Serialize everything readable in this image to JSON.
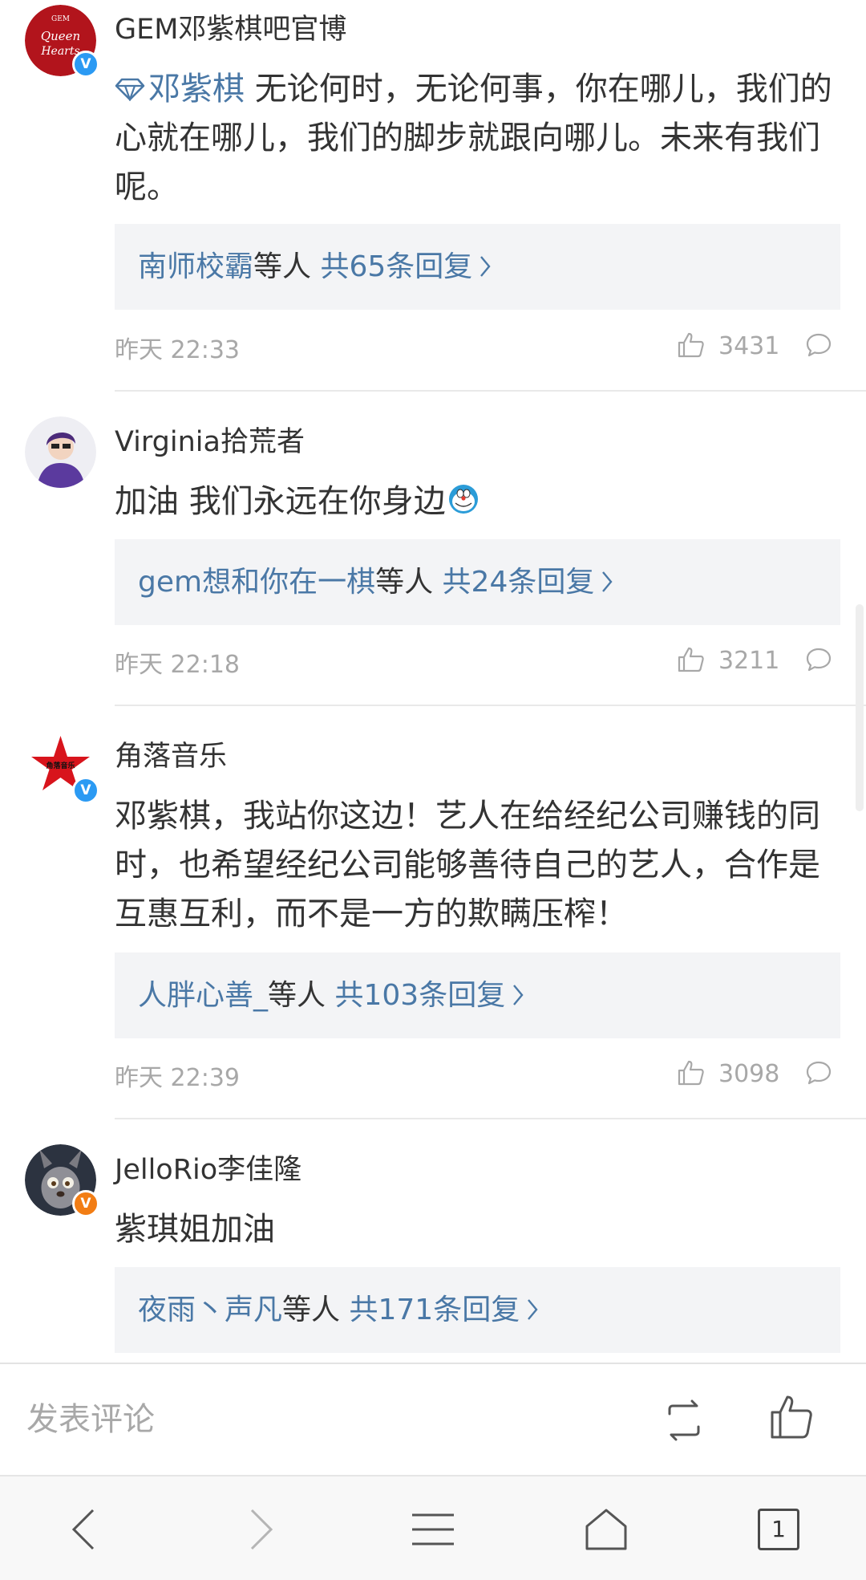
{
  "comments": [
    {
      "username": "GEM邓紫棋吧官博",
      "verified": "blue",
      "mention": "邓紫棋",
      "text": " 无论何时，无论何事，你在哪儿，我们的心就在哪儿，我们的脚步就跟向哪儿。未来有我们呢。",
      "reply_user": "南师校霸",
      "reply_mid": "等人",
      "reply_count": " 共65条回复",
      "time": "昨天 22:33",
      "likes": "3431"
    },
    {
      "username": "Virginia拾荒者",
      "verified": "",
      "text": "加油 我们永远在你身边",
      "emoji": "doraemon-emoji",
      "reply_user": "gem想和你在一棋",
      "reply_mid": "等人",
      "reply_count": " 共24条回复",
      "time": "昨天 22:18",
      "likes": "3211"
    },
    {
      "username": "角落音乐",
      "verified": "blue",
      "avatar_text": "角落音乐",
      "text": "邓紫棋，我站你这边！艺人在给经纪公司赚钱的同时，也希望经纪公司能够善待自己的艺人，合作是互惠互利，而不是一方的欺瞒压榨！",
      "reply_user": "人胖心善_",
      "reply_mid": "等人",
      "reply_count": " 共103条回复",
      "time": "昨天 22:39",
      "likes": "3098"
    },
    {
      "username": "JelloRio李佳隆",
      "verified": "orange",
      "text": "紫琪姐加油",
      "reply_user": "夜雨丶声凡",
      "reply_mid": "等人",
      "reply_count": " 共171条回复"
    }
  ],
  "verified_mark": "V",
  "composer": {
    "placeholder": "发表评论"
  },
  "browser": {
    "tab_count": "1"
  },
  "colors": {
    "link": "#4a78a6",
    "muted": "#a8a8a8",
    "reply_bg": "#f3f4f6",
    "verified_blue": "#2b9af3",
    "verified_orange": "#f27d14"
  }
}
